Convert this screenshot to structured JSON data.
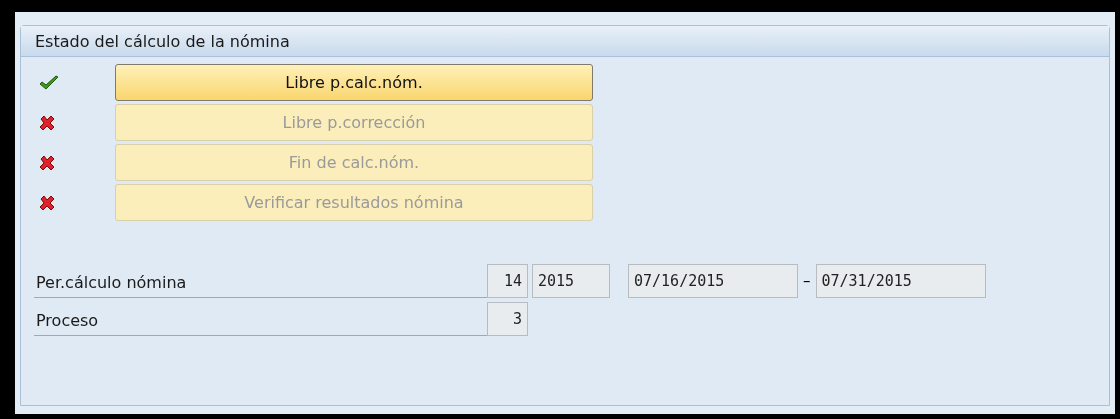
{
  "group": {
    "title": "Estado del cálculo de la nómina"
  },
  "steps": [
    {
      "done": true,
      "label": "Libre p.calc.nóm.",
      "disabled": false
    },
    {
      "done": false,
      "label": "Libre p.corrección",
      "disabled": true
    },
    {
      "done": false,
      "label": "Fin de calc.nóm.",
      "disabled": true
    },
    {
      "done": false,
      "label": "Verificar resultados nómina",
      "disabled": true
    }
  ],
  "fields": [
    {
      "label": "Per.cálculo nómina",
      "values": [
        {
          "value": "14"
        },
        {
          "value": "2015"
        },
        {
          "value": "07/16/2015"
        },
        {
          "value": "–",
          "kind": "separator"
        },
        {
          "value": "07/31/2015"
        }
      ]
    },
    {
      "label": "Proceso",
      "values": [
        {
          "value": "3"
        }
      ]
    }
  ]
}
